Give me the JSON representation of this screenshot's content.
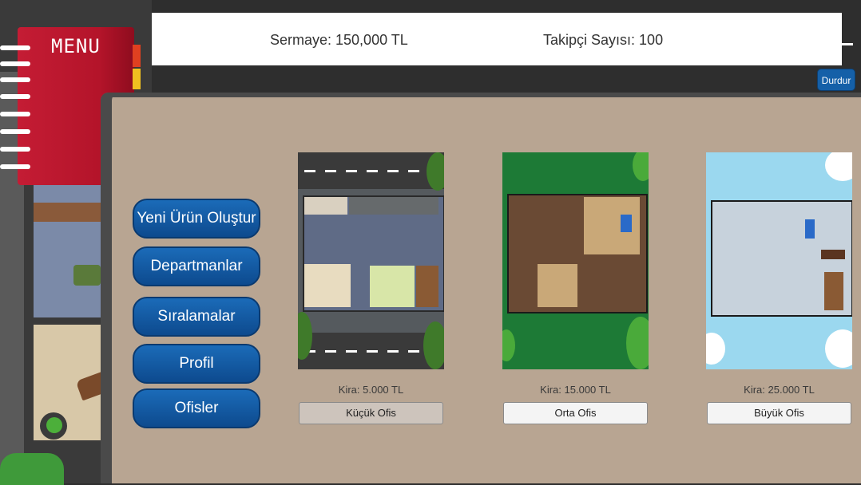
{
  "menu": {
    "label": "MENU"
  },
  "stats": {
    "capital": "Sermaye: 150,000 TL",
    "followers": "Takipçi Sayısı: 100"
  },
  "controls": {
    "pause_label": "Durdur"
  },
  "sidebar": {
    "items": [
      {
        "label": "Yeni Ürün Oluştur"
      },
      {
        "label": "Departmanlar"
      },
      {
        "label": "Sıralamalar"
      },
      {
        "label": "Profil"
      },
      {
        "label": "Ofisler"
      }
    ]
  },
  "offices": [
    {
      "rent": "Kira: 5.000 TL",
      "button": "Küçük Ofis",
      "selected": true
    },
    {
      "rent": "Kira: 15.000 TL",
      "button": "Orta Ofis",
      "selected": false
    },
    {
      "rent": "Kira: 25.000 TL",
      "button": "Büyük Ofis",
      "selected": false
    }
  ],
  "colors": {
    "menu_book": "#c41c34",
    "sidebar_button": "#1560a8",
    "panel": "#b8a592",
    "topbar": "#ffffff"
  }
}
